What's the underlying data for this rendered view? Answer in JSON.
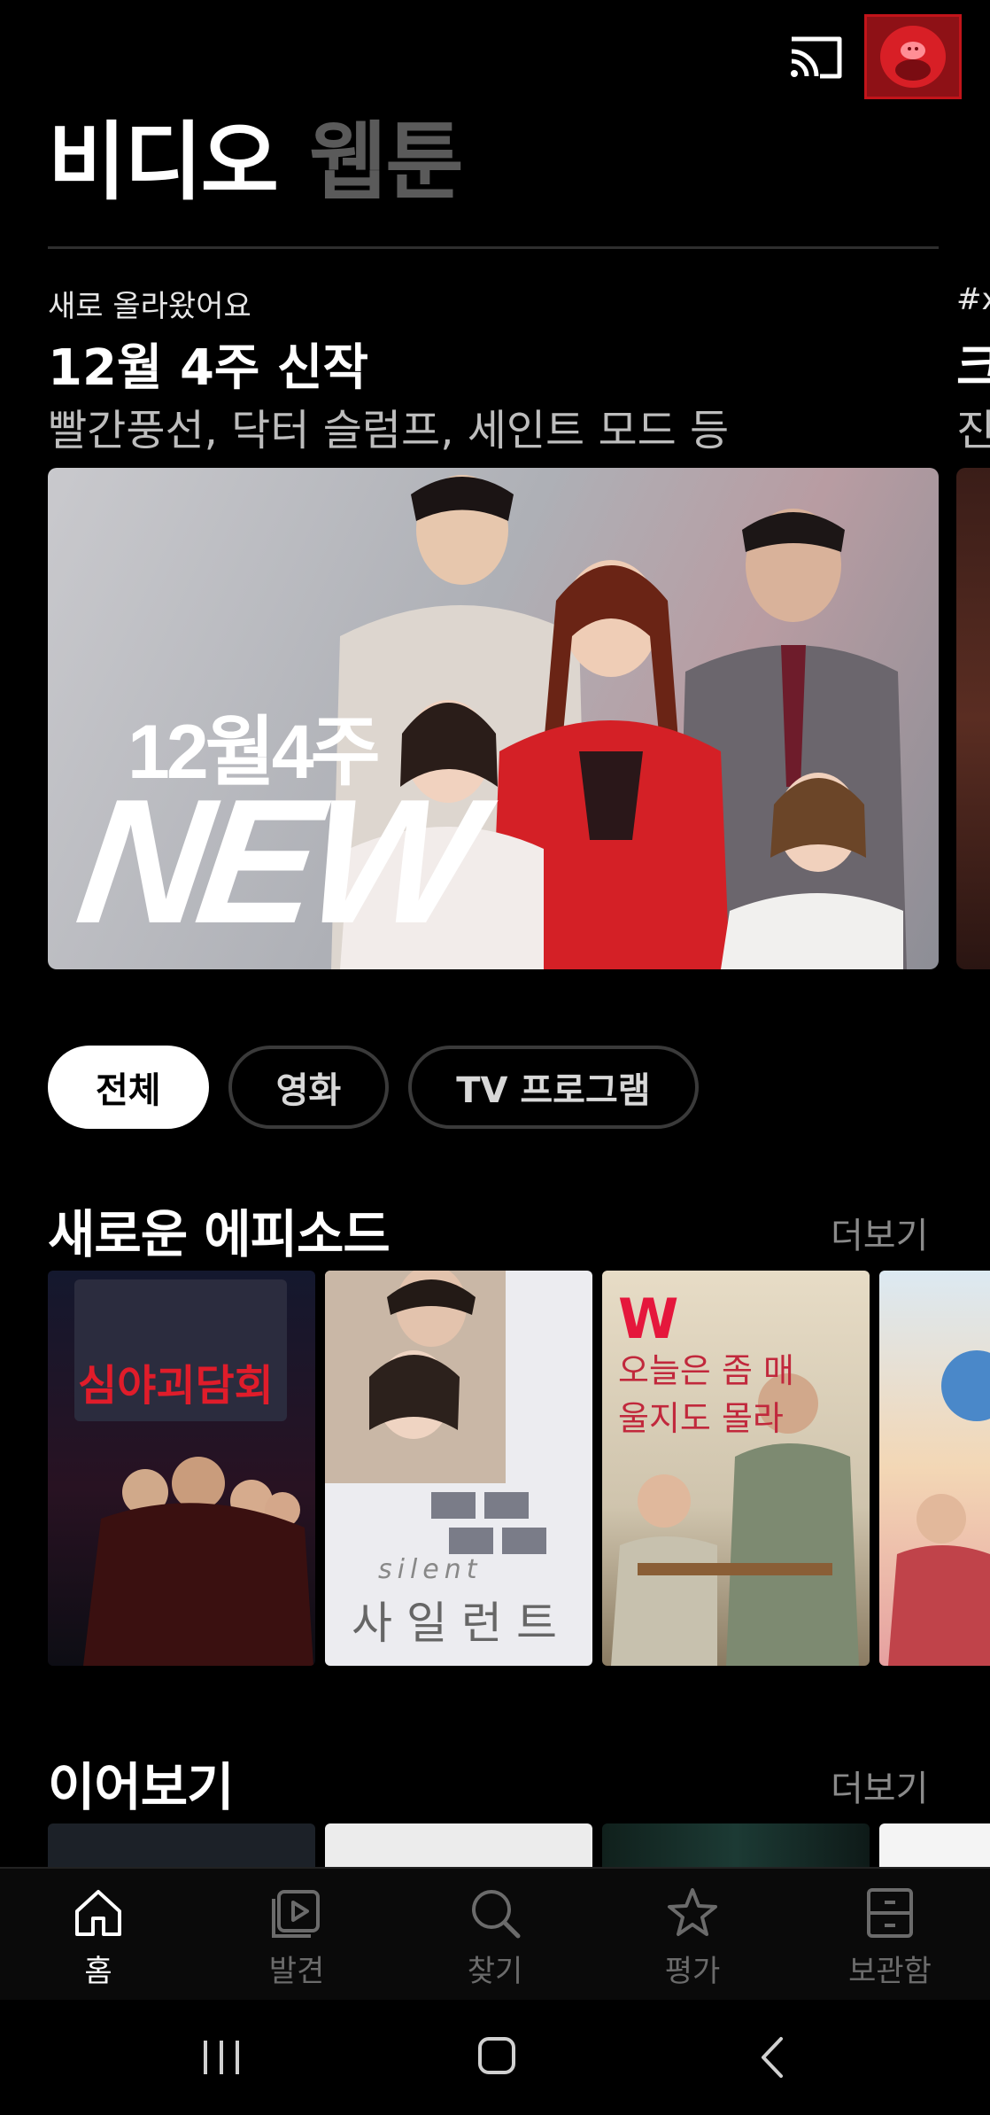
{
  "header": {
    "cast_icon": "cast-icon",
    "profile_icon": "profile-avatar"
  },
  "section_tabs": [
    {
      "label": "비디오",
      "active": true
    },
    {
      "label": "웹툰",
      "active": false
    }
  ],
  "hero": {
    "kicker": "새로 올라왔어요",
    "title": "12월 4주 신작",
    "subtitle": "빨간풍선, 닥터 슬럼프, 세인트 모드 등",
    "banner_text_line1": "12월4주",
    "banner_text_line2": "NEW",
    "peek_kicker": "#x",
    "peek_title": "크",
    "peek_subtitle": "진"
  },
  "filter_chips": [
    {
      "label": "전체",
      "active": true
    },
    {
      "label": "영화",
      "active": false
    },
    {
      "label": "TV 프로그램",
      "active": false
    }
  ],
  "new_episodes": {
    "title": "새로운 에피소드",
    "more": "더보기",
    "posters": [
      {
        "title": "심야괴담회",
        "color": "#1a1d33"
      },
      {
        "title": "사일런트",
        "subtitle": "silent",
        "color": "#e9e9ec"
      },
      {
        "title": "오늘은 좀 매울지도 몰라",
        "badge": "W",
        "color": "#d9d2c2"
      },
      {
        "title": "",
        "color": "#f1c7a4"
      }
    ]
  },
  "continue_watching": {
    "title": "이어보기",
    "more": "더보기"
  },
  "bottom_nav": [
    {
      "label": "홈",
      "icon": "home-icon",
      "active": true
    },
    {
      "label": "발견",
      "icon": "play-discover-icon",
      "active": false
    },
    {
      "label": "찾기",
      "icon": "search-icon",
      "active": false
    },
    {
      "label": "평가",
      "icon": "star-icon",
      "active": false
    },
    {
      "label": "보관함",
      "icon": "storage-box-icon",
      "active": false
    }
  ],
  "colors": {
    "accent": "#d81f26",
    "background": "#000000",
    "inactive": "#6b6b6b"
  }
}
